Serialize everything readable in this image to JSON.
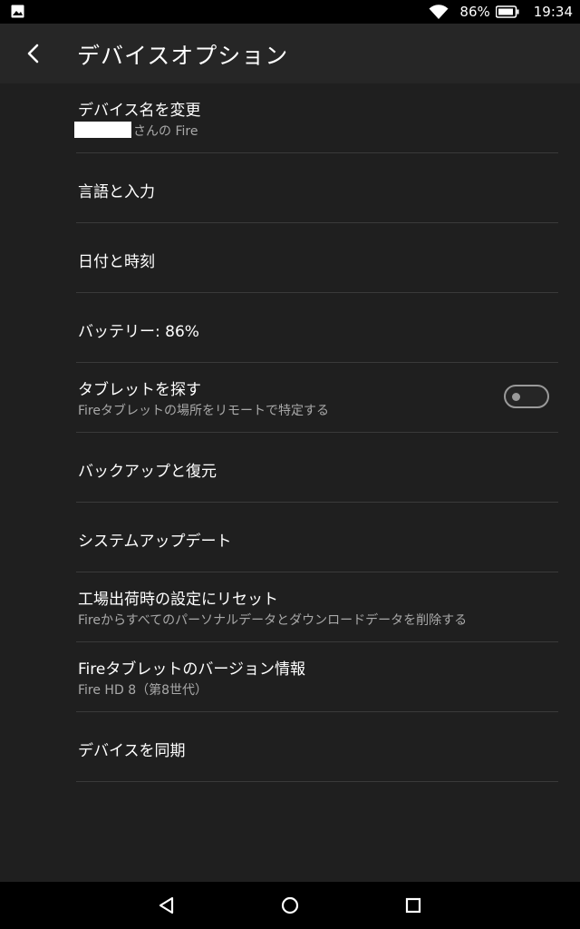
{
  "status_bar": {
    "battery_percent": "86%",
    "time": "19:34",
    "left_icon": "image-icon",
    "wifi_icon": "wifi-icon",
    "battery_icon": "battery-icon"
  },
  "app_bar": {
    "back_icon": "back-arrow-icon",
    "title": "デバイスオプション"
  },
  "items": [
    {
      "primary": "デバイス名を変更",
      "secondary": "さんの Fire",
      "has_redaction": true
    },
    {
      "primary": "言語と入力"
    },
    {
      "primary": "日付と時刻"
    },
    {
      "primary": "バッテリー: 86%"
    },
    {
      "primary": "タブレットを探す",
      "secondary": "Fireタブレットの場所をリモートで特定する",
      "toggle_on": false
    },
    {
      "primary": "バックアップと復元"
    },
    {
      "primary": "システムアップデート"
    },
    {
      "primary": "工場出荷時の設定にリセット",
      "secondary": "Fireからすべてのパーソナルデータとダウンロードデータを削除する"
    },
    {
      "primary": "Fireタブレットのバージョン情報",
      "secondary": "Fire HD 8（第8世代）"
    },
    {
      "primary": "デバイスを同期"
    }
  ],
  "nav_bar": {
    "back_icon": "nav-back-icon",
    "home_icon": "nav-home-icon",
    "recents_icon": "nav-recents-icon"
  },
  "colors": {
    "background": "#1f1f1f",
    "app_bar": "#262626",
    "secondary_text": "#a9a9a9",
    "divider": "#3a3a3a"
  }
}
